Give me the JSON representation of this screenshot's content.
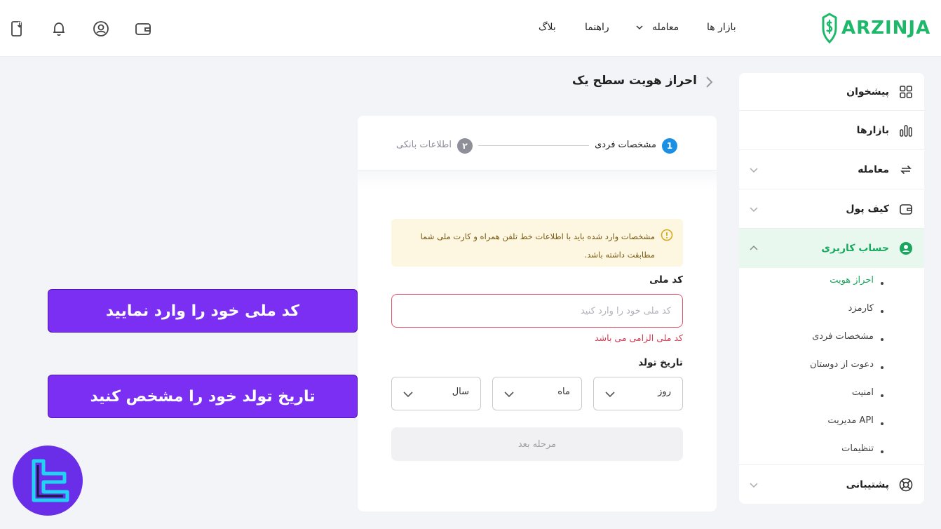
{
  "brand": {
    "name": "ARZINJA",
    "color": "#1eb86b"
  },
  "header": {
    "nav": [
      {
        "label": "بازار ها"
      },
      {
        "label": "معامله"
      },
      {
        "label": "راهنما"
      },
      {
        "label": "بلاگ"
      }
    ],
    "icons": [
      "wallet-icon",
      "user-icon",
      "bell-icon",
      "download-app-icon"
    ]
  },
  "sidebar": {
    "items": [
      {
        "label": "پیشخوان",
        "icon": "dashboard-icon"
      },
      {
        "label": "بازارها",
        "icon": "markets-icon"
      },
      {
        "label": "معامله",
        "icon": "trade-icon"
      },
      {
        "label": "کیف پول",
        "icon": "wallet-icon"
      },
      {
        "label": "حساب کاربری",
        "icon": "account-icon",
        "active": true
      },
      {
        "label": "پشتیبانی",
        "icon": "support-icon"
      }
    ],
    "submenu": [
      {
        "label": "احراز هویت",
        "active": true
      },
      {
        "label": "کارمزد"
      },
      {
        "label": "مشخصات فردی"
      },
      {
        "label": "دعوت از دوستان"
      },
      {
        "label": "امنیت"
      },
      {
        "label": "مدیریت API"
      },
      {
        "label": "تنظیمات"
      }
    ]
  },
  "page": {
    "title": "احراز هویت سطح یک"
  },
  "stepper": {
    "steps": [
      {
        "number": "1",
        "label": "مشخصات فردی",
        "active": true
      },
      {
        "number": "۲",
        "label": "اطلاعات بانکی",
        "active": false
      }
    ]
  },
  "form": {
    "alert": "مشخصات وارد شده باید با اطلاعات خط تلفن همراه و کارت ملی شما مطابقت داشته باشد.",
    "national_code": {
      "label": "کد ملی",
      "value": "",
      "placeholder": "کد ملی خود را وارد کنید",
      "error": "کد ملی الزامی می باشد"
    },
    "birth_date": {
      "label": "تاریخ تولد",
      "day": "روز",
      "month": "ماه",
      "year": "سال"
    },
    "next_button": "مرحله بعد"
  },
  "callouts": {
    "national_code": "کد ملی خود را وارد نمایید",
    "birth_date": "تاریخ تولد خود را مشخص کنید"
  },
  "colors": {
    "accent_green": "#17a85e",
    "step_active": "#1a8fe3",
    "step_inactive": "#8e8f99",
    "error": "#d03a52",
    "callout": "#7a2ff2"
  }
}
